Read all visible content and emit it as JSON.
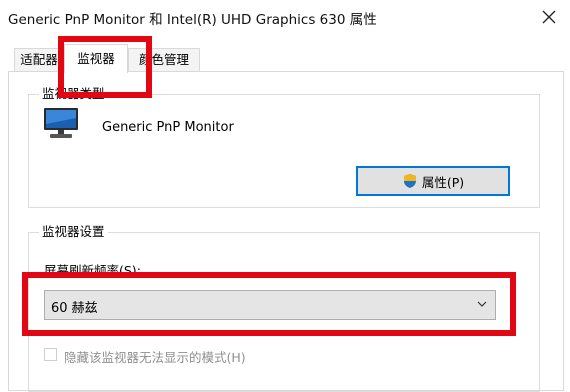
{
  "window": {
    "title": "Generic PnP Monitor 和 Intel(R) UHD Graphics 630 属性",
    "close_icon": "close-icon"
  },
  "tabs": [
    {
      "label": "适配器",
      "active": false
    },
    {
      "label": "监视器",
      "active": true
    },
    {
      "label": "颜色管理",
      "active": false
    }
  ],
  "monitor_type": {
    "group_title": "监视器类型",
    "icon": "monitor-icon",
    "name": "Generic PnP Monitor",
    "properties_button": "属性(P)",
    "button_icon": "shield-icon"
  },
  "monitor_settings": {
    "group_title": "监视器设置",
    "refresh_label": "屏幕刷新频率(S):",
    "refresh_value": "60 赫兹",
    "hide_modes_label": "隐藏该监视器无法显示的模式(H)",
    "hide_modes_checked": false,
    "hide_modes_enabled": false
  },
  "annotations": {
    "highlight_color": "#e30613"
  },
  "colors": {
    "focus_border": "#0078d7",
    "button_bg": "#e1e1e1",
    "select_bg": "#e5e5e5",
    "disabled_text": "#8f8f8f",
    "shield_blue": "#1e73c8",
    "shield_yellow": "#f2b51b"
  }
}
